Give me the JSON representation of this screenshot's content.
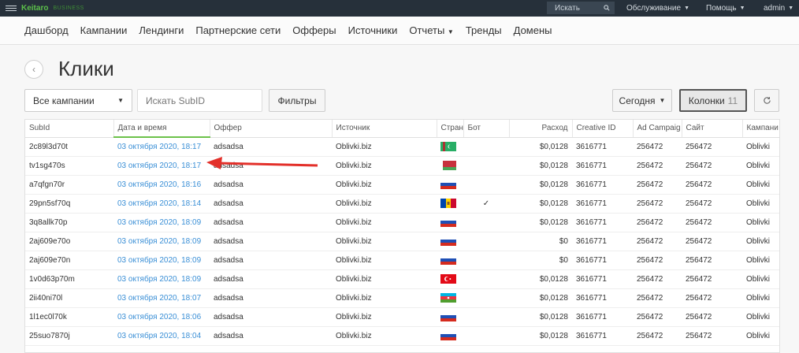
{
  "topbar": {
    "brand": "Keitaro",
    "brand_sub": "BUSINESS",
    "search_placeholder": "Искать",
    "menu_service": "Обслуживание",
    "menu_help": "Помощь",
    "menu_user": "admin"
  },
  "nav": {
    "items": [
      "Дашборд",
      "Кампании",
      "Лендинги",
      "Партнерские сети",
      "Офферы",
      "Источники",
      "Отчеты",
      "Тренды",
      "Домены"
    ],
    "reports_has_caret": true
  },
  "page": {
    "title": "Клики"
  },
  "toolbar": {
    "campaign_select": "Все кампании",
    "search_placeholder": "Искать SubID",
    "filters_label": "Фильтры",
    "period_label": "Сегодня",
    "columns_label": "Колонки",
    "columns_count": "11"
  },
  "table": {
    "columns": [
      "SubId",
      "Дата и время",
      "Оффер",
      "Источник",
      "Стран",
      "Бот",
      "Расход",
      "Creative ID",
      "Ad Campaig",
      "Сайт",
      "Кампани"
    ],
    "rows": [
      {
        "subid": "2c89l3d70t",
        "date": "03 октября 2020, 18:17",
        "offer": "adsadsa",
        "source": "Oblivki.biz",
        "flag": "turkmenistan",
        "bot": "",
        "cost": "$0,0128",
        "creative": "3616771",
        "ad_campaign": "256472",
        "site": "256472",
        "campaign": "Oblivki"
      },
      {
        "subid": "tv1sg470s",
        "date": "03 октября 2020, 18:17",
        "offer": "adsadsa",
        "source": "Oblivki.biz",
        "flag": "belarus",
        "bot": "",
        "cost": "$0,0128",
        "creative": "3616771",
        "ad_campaign": "256472",
        "site": "256472",
        "campaign": "Oblivki"
      },
      {
        "subid": "a7qfgn70r",
        "date": "03 октября 2020, 18:16",
        "offer": "adsadsa",
        "source": "Oblivki.biz",
        "flag": "russia",
        "bot": "",
        "cost": "$0,0128",
        "creative": "3616771",
        "ad_campaign": "256472",
        "site": "256472",
        "campaign": "Oblivki"
      },
      {
        "subid": "29pn5sf70q",
        "date": "03 октября 2020, 18:14",
        "offer": "adsadsa",
        "source": "Oblivki.biz",
        "flag": "moldova",
        "bot": "✓",
        "cost": "$0,0128",
        "creative": "3616771",
        "ad_campaign": "256472",
        "site": "256472",
        "campaign": "Oblivki"
      },
      {
        "subid": "3q8allk70p",
        "date": "03 октября 2020, 18:09",
        "offer": "adsadsa",
        "source": "Oblivki.biz",
        "flag": "russia",
        "bot": "",
        "cost": "$0,0128",
        "creative": "3616771",
        "ad_campaign": "256472",
        "site": "256472",
        "campaign": "Oblivki"
      },
      {
        "subid": "2aj609e70o",
        "date": "03 октября 2020, 18:09",
        "offer": "adsadsa",
        "source": "Oblivki.biz",
        "flag": "russia",
        "bot": "",
        "cost": "$0",
        "creative": "3616771",
        "ad_campaign": "256472",
        "site": "256472",
        "campaign": "Oblivki"
      },
      {
        "subid": "2aj609e70n",
        "date": "03 октября 2020, 18:09",
        "offer": "adsadsa",
        "source": "Oblivki.biz",
        "flag": "russia",
        "bot": "",
        "cost": "$0",
        "creative": "3616771",
        "ad_campaign": "256472",
        "site": "256472",
        "campaign": "Oblivki"
      },
      {
        "subid": "1v0d63p70m",
        "date": "03 октября 2020, 18:09",
        "offer": "adsadsa",
        "source": "Oblivki.biz",
        "flag": "turkey",
        "bot": "",
        "cost": "$0,0128",
        "creative": "3616771",
        "ad_campaign": "256472",
        "site": "256472",
        "campaign": "Oblivki"
      },
      {
        "subid": "2ii40ni70l",
        "date": "03 октября 2020, 18:07",
        "offer": "adsadsa",
        "source": "Oblivki.biz",
        "flag": "azerbaijan",
        "bot": "",
        "cost": "$0,0128",
        "creative": "3616771",
        "ad_campaign": "256472",
        "site": "256472",
        "campaign": "Oblivki"
      },
      {
        "subid": "1l1ec0l70k",
        "date": "03 октября 2020, 18:06",
        "offer": "adsadsa",
        "source": "Oblivki.biz",
        "flag": "russia",
        "bot": "",
        "cost": "$0,0128",
        "creative": "3616771",
        "ad_campaign": "256472",
        "site": "256472",
        "campaign": "Oblivki"
      },
      {
        "subid": "25suo7870j",
        "date": "03 октября 2020, 18:04",
        "offer": "adsadsa",
        "source": "Oblivki.biz",
        "flag": "russia",
        "bot": "",
        "cost": "$0,0128",
        "creative": "3616771",
        "ad_campaign": "256472",
        "site": "256472",
        "campaign": "Oblivki"
      }
    ]
  },
  "colors": {
    "topbar_bg": "#26303a",
    "brand": "#5cc04a",
    "link": "#3a8fd6",
    "annotation_arrow": "#e3302a",
    "sort_indicator": "#6cc24a"
  },
  "icons": {
    "menu": "hamburger-icon",
    "search": "search-icon",
    "back": "chevron-left-icon",
    "refresh": "refresh-icon",
    "bot_flag": "checkmark-icon"
  }
}
